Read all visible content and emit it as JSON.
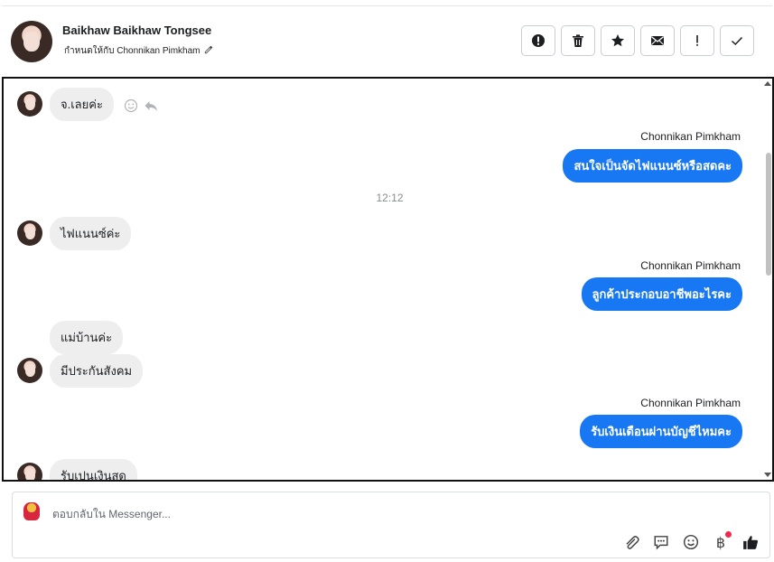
{
  "header": {
    "name": "Baikhaw Baikhaw Tongsee",
    "assigned_text": "กำหนดให้กับ Chonnikan Pimkham",
    "icons": [
      "pencil-icon"
    ],
    "toolbar": [
      {
        "id": "alert",
        "icon": "alert-circle-icon"
      },
      {
        "id": "delete",
        "icon": "trash-icon"
      },
      {
        "id": "star",
        "icon": "star-icon"
      },
      {
        "id": "mail",
        "icon": "envelope-icon"
      },
      {
        "id": "important",
        "icon": "exclamation-icon"
      },
      {
        "id": "done",
        "icon": "check-icon"
      }
    ]
  },
  "chat": {
    "messages": [
      {
        "dir": "in",
        "text": "จ.เลยค่ะ",
        "avatar": true
      },
      {
        "dir": "out",
        "sender": "Chonnikan Pimkham",
        "text": "สนใจเป็นจัดไฟแนนซ์หรือสดคะ"
      },
      {
        "dir": "time",
        "text": "12:12"
      },
      {
        "dir": "in",
        "text": "ไฟแนนซ์ค่ะ",
        "avatar": true
      },
      {
        "dir": "out",
        "sender": "Chonnikan Pimkham",
        "text": "ลูกค้าประกอบอาชีพอะไรคะ"
      },
      {
        "dir": "in",
        "text": "แม่บ้านค่ะ",
        "avatar": false
      },
      {
        "dir": "in",
        "text": "มีประกันสังคม",
        "avatar": true
      },
      {
        "dir": "out",
        "sender": "Chonnikan Pimkham",
        "text": "รับเงินเดือนผ่านบัญชีไหมคะ"
      },
      {
        "dir": "in",
        "text": "รับเปนเงินสด",
        "avatar": true
      }
    ]
  },
  "composer": {
    "placeholder": "ตอบกลับใน Messenger...",
    "tools": [
      "paperclip-icon",
      "speech-bubble-icon",
      "smile-icon",
      "baht-icon",
      "thumbs-up-icon"
    ],
    "baht_symbol": "฿"
  },
  "colors": {
    "outgoing_bubble": "#1877f2",
    "incoming_bubble": "#eeeeee",
    "notification_dot": "#f02849"
  }
}
